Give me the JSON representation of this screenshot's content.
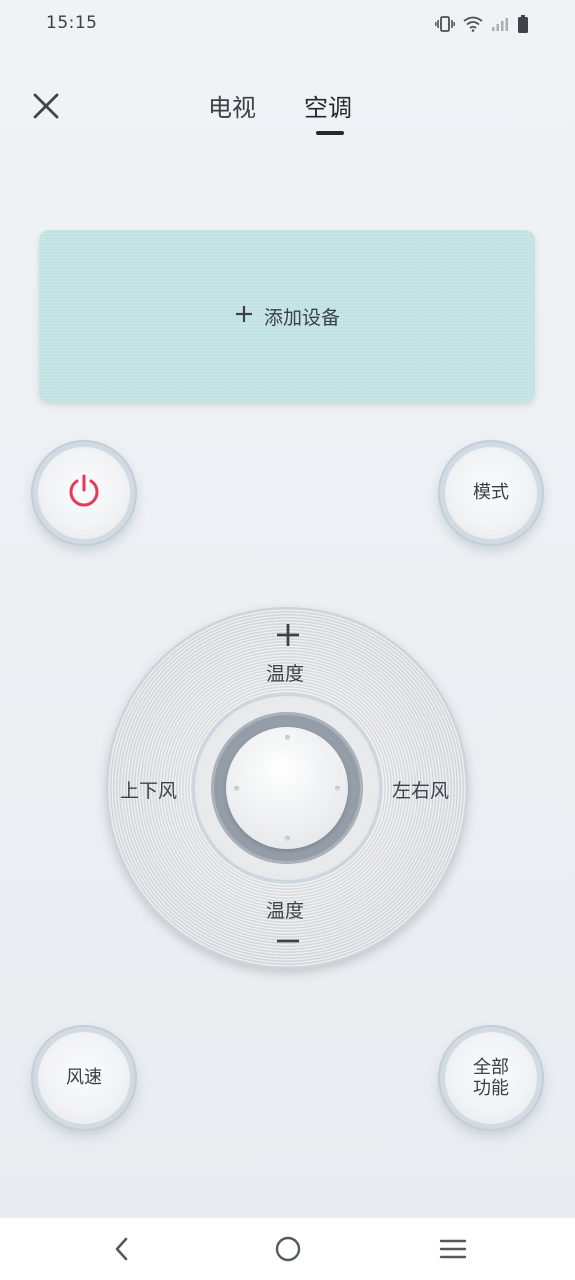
{
  "status_bar": {
    "time": "15:15",
    "icons": [
      "vibrate-icon",
      "wifi-icon",
      "signal-icon",
      "battery-icon"
    ]
  },
  "header": {
    "close_icon": "close-icon",
    "tabs": [
      {
        "label": "电视",
        "active": false
      },
      {
        "label": "空调",
        "active": true
      }
    ]
  },
  "add_device": {
    "icon": "plus-icon",
    "label": "添加设备"
  },
  "buttons": {
    "power": {
      "icon": "power-icon",
      "color": "#e8385a"
    },
    "mode": {
      "label": "模式"
    },
    "fan_speed": {
      "label": "风速"
    },
    "all_functions": {
      "line1": "全部",
      "line2": "功能"
    }
  },
  "dial": {
    "top_label": "温度",
    "top_icon": "plus-icon",
    "bottom_label": "温度",
    "bottom_icon": "minus-icon",
    "left_label": "上下风",
    "right_label": "左右风"
  },
  "nav_bar": {
    "icons": [
      "back-icon",
      "home-icon",
      "menu-icon"
    ]
  }
}
